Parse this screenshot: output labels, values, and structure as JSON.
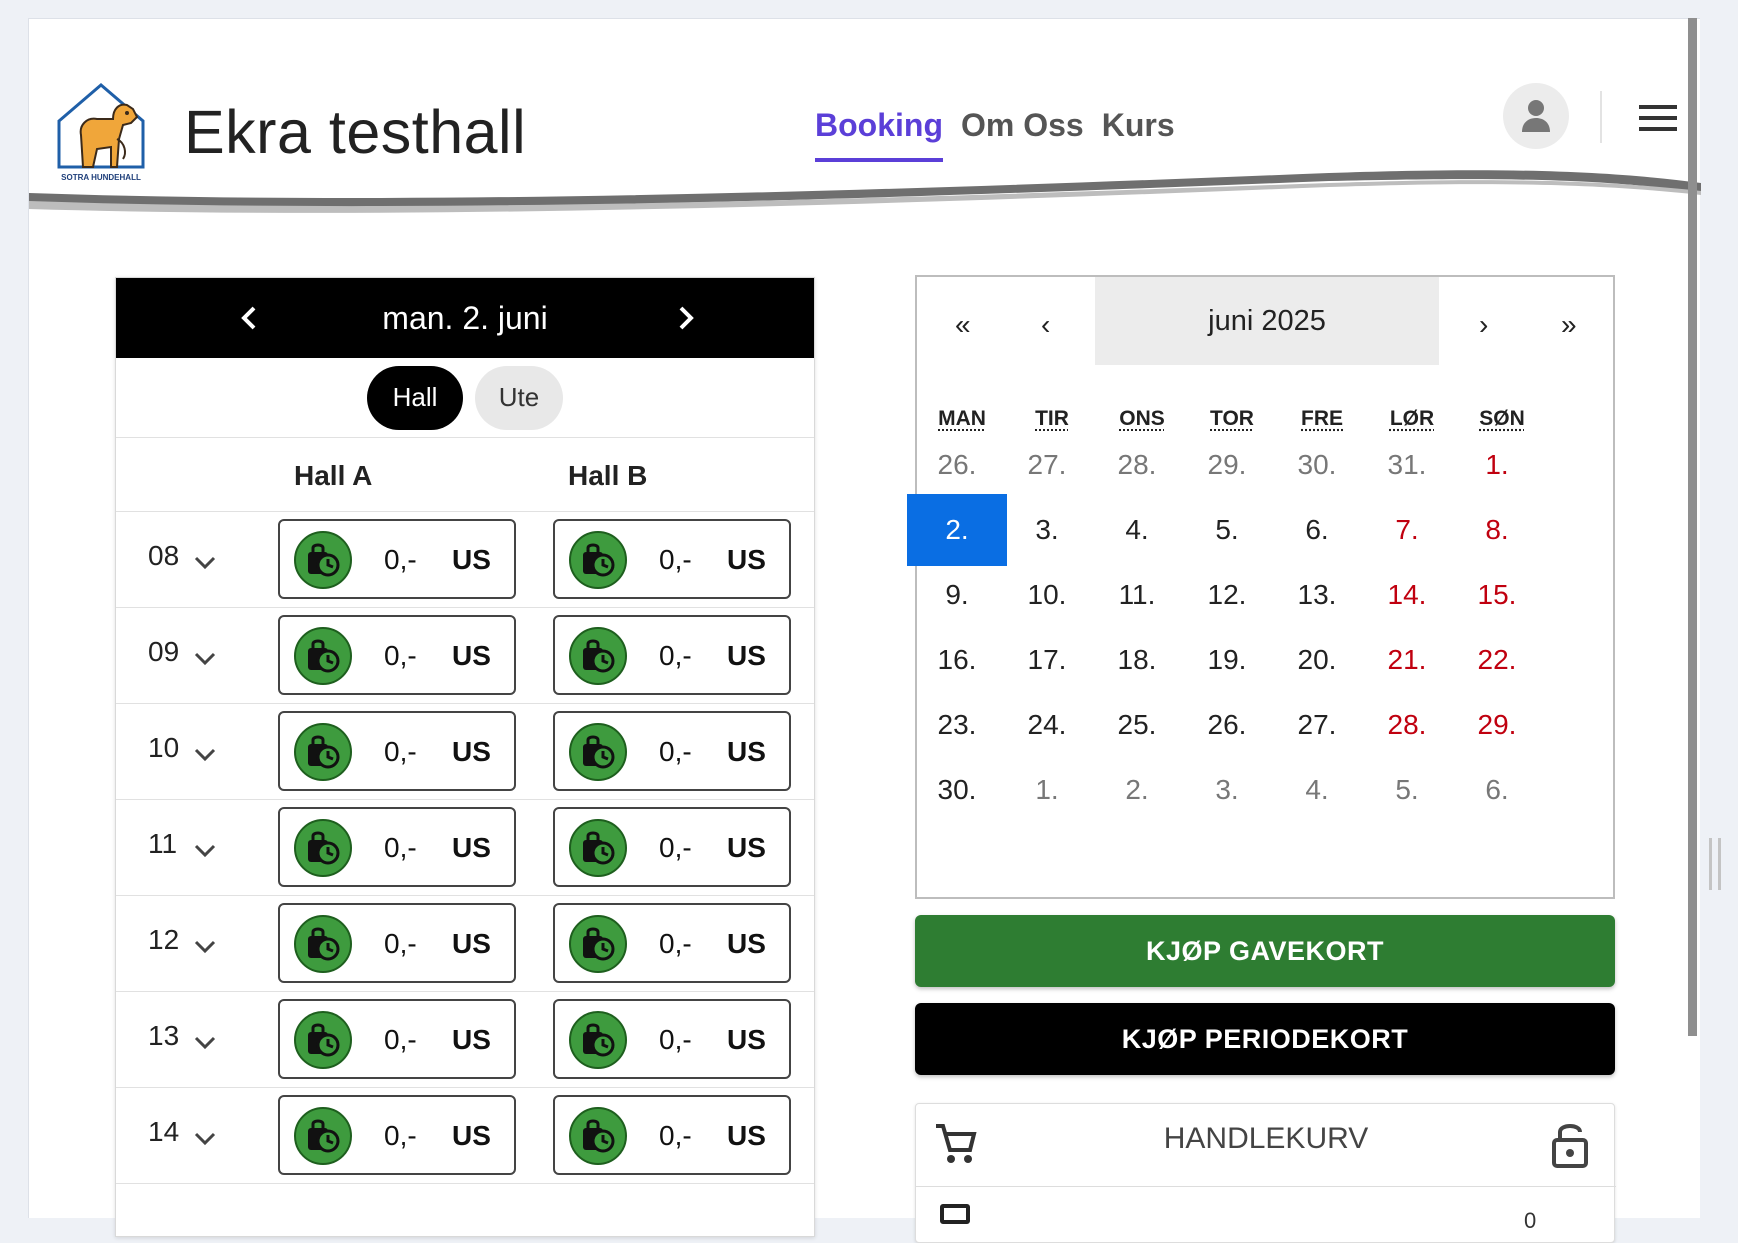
{
  "header": {
    "logo_text": "SOTRA HUNDEHALL",
    "site_title": "Ekra testhall",
    "nav": [
      {
        "label": "Booking",
        "active": true
      },
      {
        "label": "Om Oss",
        "active": false
      },
      {
        "label": "Kurs",
        "active": false
      }
    ]
  },
  "schedule": {
    "date_label": "man. 2. juni",
    "toggles": [
      "Hall",
      "Ute"
    ],
    "active_toggle": "Hall",
    "halls": [
      "Hall A",
      "Hall B"
    ],
    "rows": [
      {
        "hour": "08",
        "slots": [
          {
            "price": "0,-",
            "unit": "US"
          },
          {
            "price": "0,-",
            "unit": "US"
          }
        ]
      },
      {
        "hour": "09",
        "slots": [
          {
            "price": "0,-",
            "unit": "US"
          },
          {
            "price": "0,-",
            "unit": "US"
          }
        ]
      },
      {
        "hour": "10",
        "slots": [
          {
            "price": "0,-",
            "unit": "US"
          },
          {
            "price": "0,-",
            "unit": "US"
          }
        ]
      },
      {
        "hour": "11",
        "slots": [
          {
            "price": "0,-",
            "unit": "US"
          },
          {
            "price": "0,-",
            "unit": "US"
          }
        ]
      },
      {
        "hour": "12",
        "slots": [
          {
            "price": "0,-",
            "unit": "US"
          },
          {
            "price": "0,-",
            "unit": "US"
          }
        ]
      },
      {
        "hour": "13",
        "slots": [
          {
            "price": "0,-",
            "unit": "US"
          },
          {
            "price": "0,-",
            "unit": "US"
          }
        ]
      },
      {
        "hour": "14",
        "slots": [
          {
            "price": "0,-",
            "unit": "US"
          },
          {
            "price": "0,-",
            "unit": "US"
          }
        ]
      }
    ]
  },
  "calendar": {
    "nav": {
      "first": "«",
      "prev": "‹",
      "next": "›",
      "last": "»"
    },
    "month_label": "juni 2025",
    "weekdays": [
      "MAN",
      "TIR",
      "ONS",
      "TOR",
      "FRE",
      "LØR",
      "SØN"
    ],
    "weeks": [
      [
        "26.",
        "27.",
        "28.",
        "29.",
        "30.",
        "31.",
        "1."
      ],
      [
        "2.",
        "3.",
        "4.",
        "5.",
        "6.",
        "7.",
        "8."
      ],
      [
        "9.",
        "10.",
        "11.",
        "12.",
        "13.",
        "14.",
        "15."
      ],
      [
        "16.",
        "17.",
        "18.",
        "19.",
        "20.",
        "21.",
        "22."
      ],
      [
        "23.",
        "24.",
        "25.",
        "26.",
        "27.",
        "28.",
        "29."
      ],
      [
        "30.",
        "1.",
        "2.",
        "3.",
        "4.",
        "5.",
        "6."
      ]
    ],
    "selected_day": "2.",
    "colors": {
      "selected": "#0a6ee3",
      "weekend": "#c0000f",
      "outside_month": "#777777"
    }
  },
  "buttons": {
    "gift_card": "KJØP GAVEKORT",
    "period_card": "KJØP PERIODEKORT"
  },
  "cart": {
    "title": "HANDLEKURV",
    "count": "0"
  },
  "colors": {
    "accent": "#5b3fd8",
    "slot_green": "#3e9b3e",
    "gift_button": "#2e7d32"
  }
}
